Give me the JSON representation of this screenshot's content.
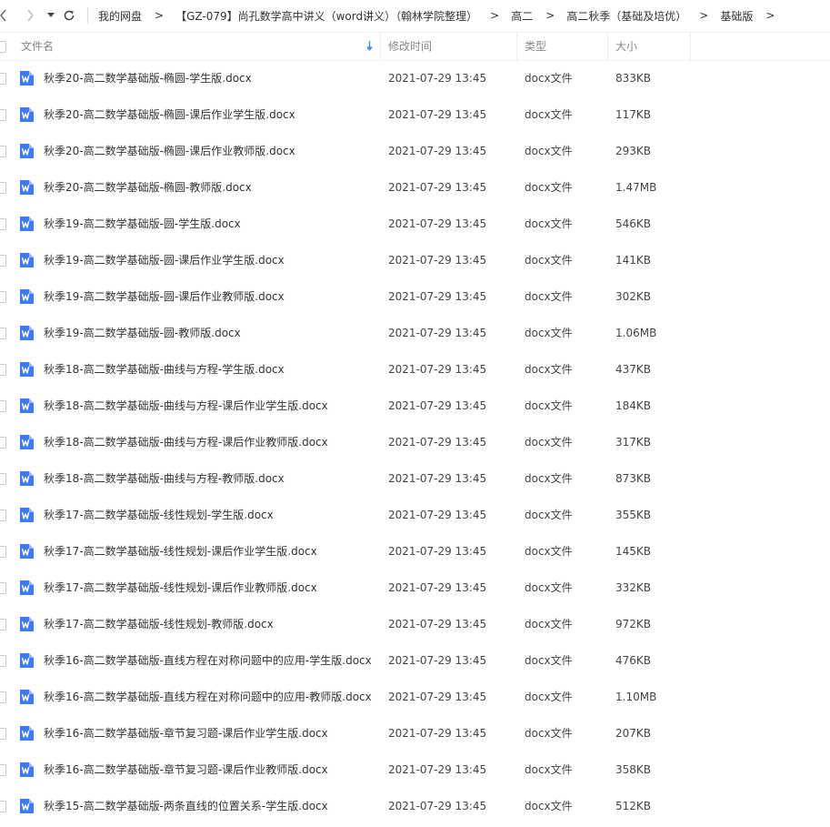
{
  "toolbar": {
    "back_icon": "chevron-left-icon",
    "forward_icon": "chevron-right-icon",
    "history_icon": "caret-down-icon",
    "refresh_icon": "refresh-icon"
  },
  "breadcrumb": {
    "items": [
      "我的网盘",
      "【GZ-079】尚孔数学高中讲义（word讲义）（翰林学院整理）",
      "高二",
      "高二秋季（基础及培优）",
      "基础版"
    ],
    "separator": ">"
  },
  "columns": {
    "name": "文件名",
    "modified": "修改时间",
    "type": "类型",
    "size": "大小",
    "sort_icon": "sort-down-arrow-icon"
  },
  "colors": {
    "word_icon": "#3c7bf5",
    "sort_arrow": "#3a86f4"
  },
  "files": [
    {
      "name": "秋季20-高二数学基础版-椭圆-学生版.docx",
      "modified": "2021-07-29 13:45",
      "type": "docx文件",
      "size": "833KB"
    },
    {
      "name": "秋季20-高二数学基础版-椭圆-课后作业学生版.docx",
      "modified": "2021-07-29 13:45",
      "type": "docx文件",
      "size": "117KB"
    },
    {
      "name": "秋季20-高二数学基础版-椭圆-课后作业教师版.docx",
      "modified": "2021-07-29 13:45",
      "type": "docx文件",
      "size": "293KB"
    },
    {
      "name": "秋季20-高二数学基础版-椭圆-教师版.docx",
      "modified": "2021-07-29 13:45",
      "type": "docx文件",
      "size": "1.47MB"
    },
    {
      "name": "秋季19-高二数学基础版-圆-学生版.docx",
      "modified": "2021-07-29 13:45",
      "type": "docx文件",
      "size": "546KB"
    },
    {
      "name": "秋季19-高二数学基础版-圆-课后作业学生版.docx",
      "modified": "2021-07-29 13:45",
      "type": "docx文件",
      "size": "141KB"
    },
    {
      "name": "秋季19-高二数学基础版-圆-课后作业教师版.docx",
      "modified": "2021-07-29 13:45",
      "type": "docx文件",
      "size": "302KB"
    },
    {
      "name": "秋季19-高二数学基础版-圆-教师版.docx",
      "modified": "2021-07-29 13:45",
      "type": "docx文件",
      "size": "1.06MB"
    },
    {
      "name": "秋季18-高二数学基础版-曲线与方程-学生版.docx",
      "modified": "2021-07-29 13:45",
      "type": "docx文件",
      "size": "437KB"
    },
    {
      "name": "秋季18-高二数学基础版-曲线与方程-课后作业学生版.docx",
      "modified": "2021-07-29 13:45",
      "type": "docx文件",
      "size": "184KB"
    },
    {
      "name": "秋季18-高二数学基础版-曲线与方程-课后作业教师版.docx",
      "modified": "2021-07-29 13:45",
      "type": "docx文件",
      "size": "317KB"
    },
    {
      "name": "秋季18-高二数学基础版-曲线与方程-教师版.docx",
      "modified": "2021-07-29 13:45",
      "type": "docx文件",
      "size": "873KB"
    },
    {
      "name": "秋季17-高二数学基础版-线性规划-学生版.docx",
      "modified": "2021-07-29 13:45",
      "type": "docx文件",
      "size": "355KB"
    },
    {
      "name": "秋季17-高二数学基础版-线性规划-课后作业学生版.docx",
      "modified": "2021-07-29 13:45",
      "type": "docx文件",
      "size": "145KB"
    },
    {
      "name": "秋季17-高二数学基础版-线性规划-课后作业教师版.docx",
      "modified": "2021-07-29 13:45",
      "type": "docx文件",
      "size": "332KB"
    },
    {
      "name": "秋季17-高二数学基础版-线性规划-教师版.docx",
      "modified": "2021-07-29 13:45",
      "type": "docx文件",
      "size": "972KB"
    },
    {
      "name": "秋季16-高二数学基础版-直线方程在对称问题中的应用-学生版.docx",
      "modified": "2021-07-29 13:45",
      "type": "docx文件",
      "size": "476KB"
    },
    {
      "name": "秋季16-高二数学基础版-直线方程在对称问题中的应用-教师版.docx",
      "modified": "2021-07-29 13:45",
      "type": "docx文件",
      "size": "1.10MB"
    },
    {
      "name": "秋季16-高二数学基础版-章节复习题-课后作业学生版.docx",
      "modified": "2021-07-29 13:45",
      "type": "docx文件",
      "size": "207KB"
    },
    {
      "name": "秋季16-高二数学基础版-章节复习题-课后作业教师版.docx",
      "modified": "2021-07-29 13:45",
      "type": "docx文件",
      "size": "358KB"
    },
    {
      "name": "秋季15-高二数学基础版-两条直线的位置关系-学生版.docx",
      "modified": "2021-07-29 13:45",
      "type": "docx文件",
      "size": "512KB"
    }
  ]
}
